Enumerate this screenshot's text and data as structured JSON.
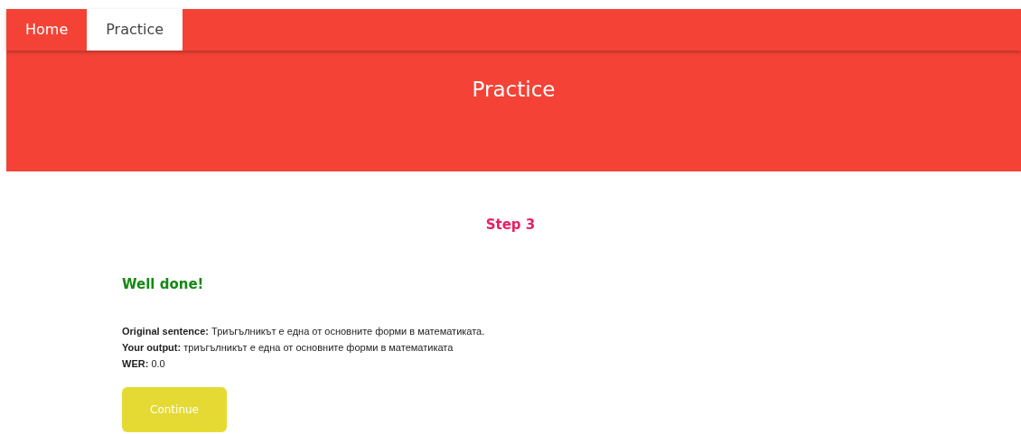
{
  "nav": {
    "tabs": [
      {
        "label": "Home",
        "selected": false
      },
      {
        "label": "Practice",
        "selected": true
      }
    ]
  },
  "header": {
    "title": "Practice"
  },
  "step": "Step 3",
  "feedback": "Well done!",
  "results": [
    "**Original sentence:** Триъгълникът е една от основните форми в математиката.",
    "**Your output:** триъгълникът е една от основните форми в математиката",
    "**WER:** 0.0"
  ],
  "continue_button": "Continue"
}
